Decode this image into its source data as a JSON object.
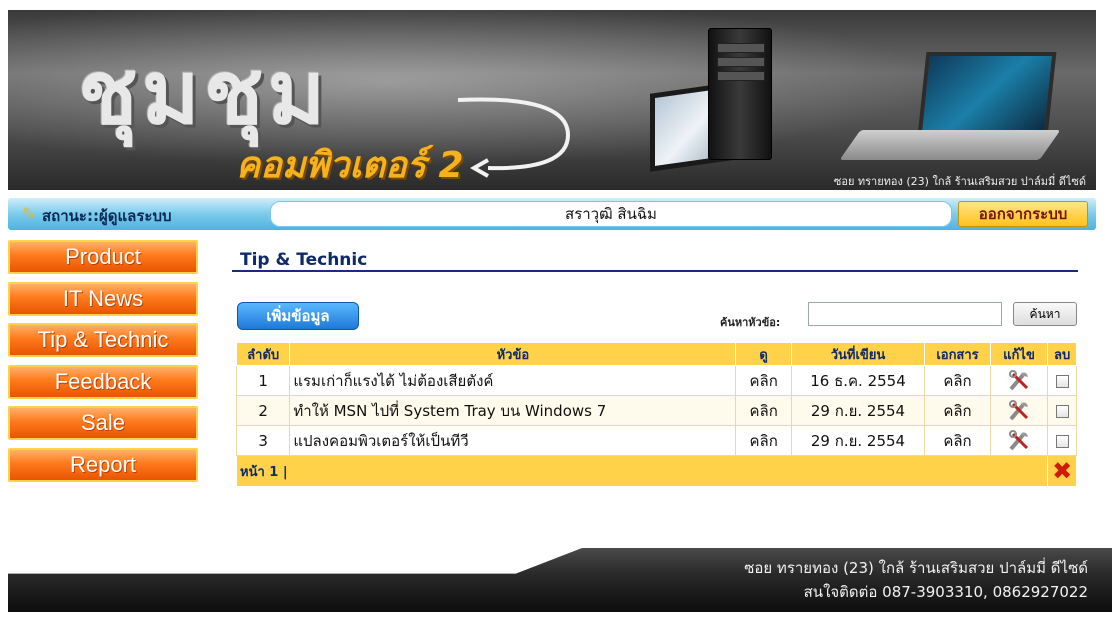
{
  "banner": {
    "logo_main": "ชุมชุม",
    "logo_sub": "คอมพิวเตอร์ 2",
    "address": "ซอย ทรายทอง (23) ใกล้ ร้านเสริมสวย ปาล์มมี่ ดีไซด์"
  },
  "status": {
    "label": "สถานะ::ผู้ดูแลระบบ",
    "user": "สราวุฒิ  สินฉิม",
    "logout": "ออกจากระบบ"
  },
  "sidebar": {
    "items": [
      {
        "label": "Product"
      },
      {
        "label": "IT News"
      },
      {
        "label": "Tip & Technic"
      },
      {
        "label": "Feedback"
      },
      {
        "label": "Sale"
      },
      {
        "label": "Report"
      }
    ]
  },
  "main": {
    "title": "Tip & Technic",
    "add_label": "เพิ่มข้อมูล",
    "search_label": "ค้นหาหัวข้อ:",
    "search_value": "",
    "search_button": "ค้นหา"
  },
  "table": {
    "headers": [
      "ลำดับ",
      "หัวข้อ",
      "ดู",
      "วันที่เขียน",
      "เอกสาร",
      "แก้ไข",
      "ลบ"
    ],
    "rows": [
      {
        "no": "1",
        "topic": "แรมเก่าก็แรงได้ ไม่ต้องเสียตังค์",
        "view": "คลิก",
        "date": "16 ธ.ค. 2554",
        "doc": "คลิก"
      },
      {
        "no": "2",
        "topic": "ทำให้ MSN ไปที่ System Tray บน Windows 7",
        "view": "คลิก",
        "date": "29 ก.ย. 2554",
        "doc": "คลิก"
      },
      {
        "no": "3",
        "topic": "แปลงคอมพิวเตอร์ให้เป็นทีวี",
        "view": "คลิก",
        "date": "29 ก.ย. 2554",
        "doc": "คลิก"
      }
    ],
    "pager": "หน้า 1 |"
  },
  "footer": {
    "address": "ซอย ทรายทอง (23) ใกล้ ร้านเสริมสวย ปาล์มมี่ ดีไซด์",
    "contact": "สนใจติดต่อ 087-3903310, 0862927022"
  },
  "colors": {
    "menu_orange": "#ff7a1c",
    "header_yellow": "#ffd24a",
    "status_blue": "#7ccbec",
    "link_blue": "#1a5aa8"
  }
}
